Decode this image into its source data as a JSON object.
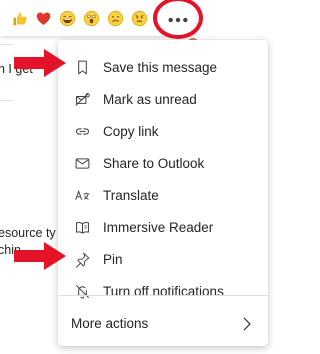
{
  "background": {
    "fragment_1": "n I get",
    "fragment_2": "esource ty",
    "fragment_3": "chin"
  },
  "reactions": [
    {
      "name": "like-reaction",
      "icon": "thumbs-up-icon",
      "color": "#f4b400"
    },
    {
      "name": "heart-reaction",
      "icon": "heart-icon",
      "color": "#e0382f"
    },
    {
      "name": "laugh-reaction",
      "icon": "laughing-face-icon",
      "color": "#f4c430"
    },
    {
      "name": "surprised-reaction",
      "icon": "surprised-face-icon",
      "color": "#f4c430"
    },
    {
      "name": "sad-reaction",
      "icon": "sad-face-icon",
      "color": "#f4c430"
    },
    {
      "name": "angry-reaction",
      "icon": "angry-face-icon",
      "color": "#f4c430"
    }
  ],
  "more_options": {
    "icon": "more-options-icon"
  },
  "menu": {
    "items": [
      {
        "label": "Save this message",
        "icon": "bookmark-icon"
      },
      {
        "label": "Mark as unread",
        "icon": "mark-unread-icon"
      },
      {
        "label": "Copy link",
        "icon": "link-icon"
      },
      {
        "label": "Share to Outlook",
        "icon": "mail-icon"
      },
      {
        "label": "Translate",
        "icon": "translate-icon"
      },
      {
        "label": "Immersive Reader",
        "icon": "immersive-reader-icon"
      },
      {
        "label": "Pin",
        "icon": "pin-icon"
      },
      {
        "label": "Turn off notifications",
        "icon": "bell-off-icon"
      }
    ],
    "more_actions_label": "More actions"
  },
  "annotation_color": "#e3142a"
}
